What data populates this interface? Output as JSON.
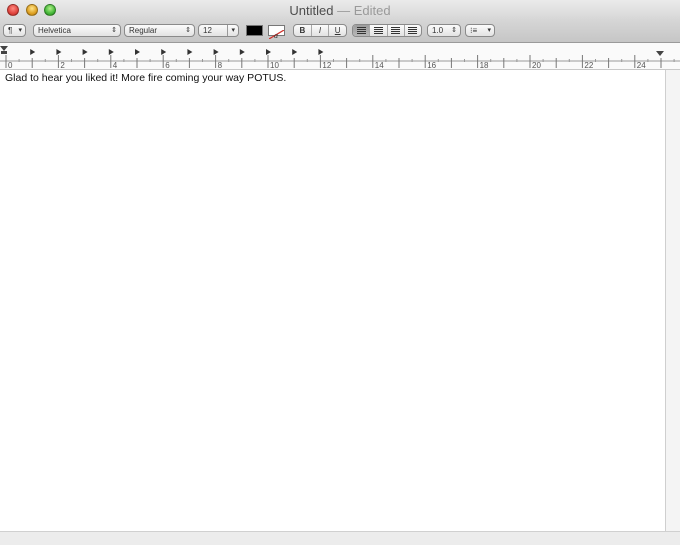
{
  "window": {
    "title": "Untitled",
    "status": " — Edited"
  },
  "toolbar": {
    "paragraph_styles": "¶",
    "font_family": "Helvetica",
    "font_typeface": "Regular",
    "font_size": "12",
    "text_color": "#000000",
    "highlight_color": "#ffffff",
    "bold": "B",
    "italic": "I",
    "underline": "U",
    "alignment_selected": "left",
    "line_spacing": "1.0",
    "list_icon": "list-bullets-icon"
  },
  "ruler": {
    "labels": [
      "0",
      "2",
      "4",
      "6",
      "8",
      "10",
      "12",
      "14",
      "16",
      "18",
      "20",
      "22",
      "24"
    ]
  },
  "document": {
    "text": "Glad to hear you liked it! More fire coming your way POTUS."
  },
  "colors": {
    "close": "#e0443e",
    "minimize": "#dea123",
    "zoom": "#46b83a"
  }
}
